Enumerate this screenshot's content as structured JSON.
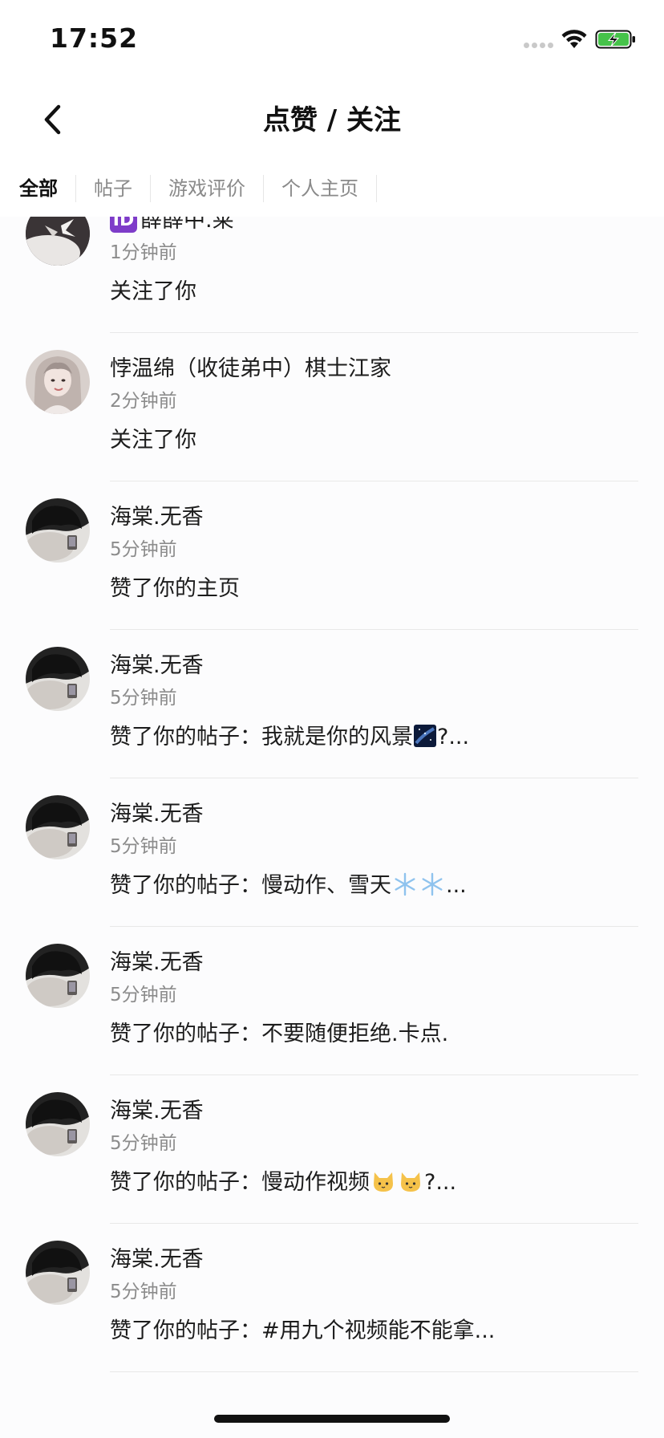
{
  "status_bar": {
    "time": "17:52"
  },
  "nav": {
    "title": "点赞 / 关注"
  },
  "tabs": [
    {
      "label": "全部",
      "active": true
    },
    {
      "label": "帖子",
      "active": false
    },
    {
      "label": "游戏评价",
      "active": false
    },
    {
      "label": "个人主页",
      "active": false
    }
  ],
  "notifications": [
    {
      "username": "薛薛中.莱",
      "time": "1分钟前",
      "action": "关注了你",
      "avatar": "white-figure-avatar"
    },
    {
      "username": "悖温绵（收徒弟中）棋士江家",
      "time": "2分钟前",
      "action": "关注了你",
      "avatar": "girl-avatar"
    },
    {
      "username": "海棠.无香",
      "time": "5分钟前",
      "action": "赞了你的主页",
      "avatar": "dark-avatar"
    },
    {
      "username": "海棠.无香",
      "time": "5分钟前",
      "action": "赞了你的帖子：我就是你的风景",
      "suffix": "?...",
      "emoji": "galaxy-emoji",
      "avatar": "dark-avatar"
    },
    {
      "username": "海棠.无香",
      "time": "5分钟前",
      "action": "赞了你的帖子：慢动作、雪天",
      "suffix": "...",
      "emoji": "snowflake-emoji",
      "avatar": "dark-avatar"
    },
    {
      "username": "海棠.无香",
      "time": "5分钟前",
      "action": "赞了你的帖子：不要随便拒绝.卡点.",
      "avatar": "dark-avatar"
    },
    {
      "username": "海棠.无香",
      "time": "5分钟前",
      "action": "赞了你的帖子：慢动作视频",
      "suffix": "?...",
      "emoji": "cat-emoji",
      "avatar": "dark-avatar"
    },
    {
      "username": "海棠.无香",
      "time": "5分钟前",
      "action": "赞了你的帖子：#用九个视频能不能拿...",
      "avatar": "dark-avatar"
    }
  ],
  "colors": {
    "id_badge": "#7e3cc9",
    "battery_green": "#46c34a"
  }
}
